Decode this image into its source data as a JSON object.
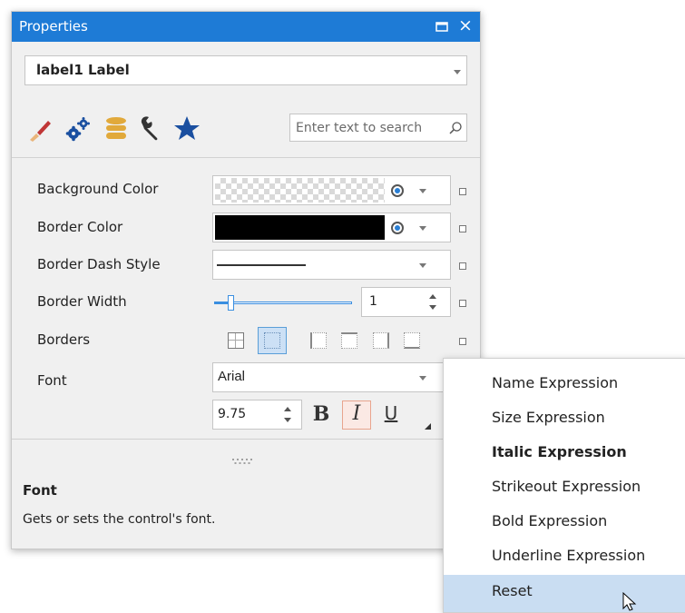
{
  "panel": {
    "title": "Properties",
    "maximize_icon": "maximize-icon",
    "close_glyph": "×"
  },
  "selector": {
    "value": "label1  Label"
  },
  "toolbar": {
    "icons": [
      "brush-icon",
      "gears-icon",
      "database-icon",
      "wrench-icon",
      "star-icon"
    ],
    "search_placeholder": "Enter text to search"
  },
  "properties": {
    "background_color": {
      "label": "Background Color",
      "color": "transparent"
    },
    "border_color": {
      "label": "Border Color",
      "color": "#000000"
    },
    "border_dash_style": {
      "label": "Border Dash Style",
      "value": "solid"
    },
    "border_width": {
      "label": "Border Width",
      "value": "1",
      "slider_fraction": 0.12
    },
    "borders": {
      "label": "Borders"
    },
    "font": {
      "label": "Font",
      "family": "Arial",
      "size": "9.75",
      "bold": "B",
      "italic": "I",
      "underline": "U"
    }
  },
  "description": {
    "title": "Font",
    "text": "Gets or sets the control's font."
  },
  "context_menu": {
    "items": [
      {
        "label": "Name Expression"
      },
      {
        "label": "Size Expression"
      },
      {
        "label": "Italic Expression"
      },
      {
        "label": "Strikeout Expression"
      },
      {
        "label": "Bold Expression"
      },
      {
        "label": "Underline Expression"
      },
      {
        "label": "Reset"
      }
    ]
  },
  "colors": {
    "title_bar": "#1e7bd6",
    "accent_blue": "#1a4fa0",
    "database_gold": "#e1a93b",
    "menu_highlight": "#c9ddf2"
  }
}
